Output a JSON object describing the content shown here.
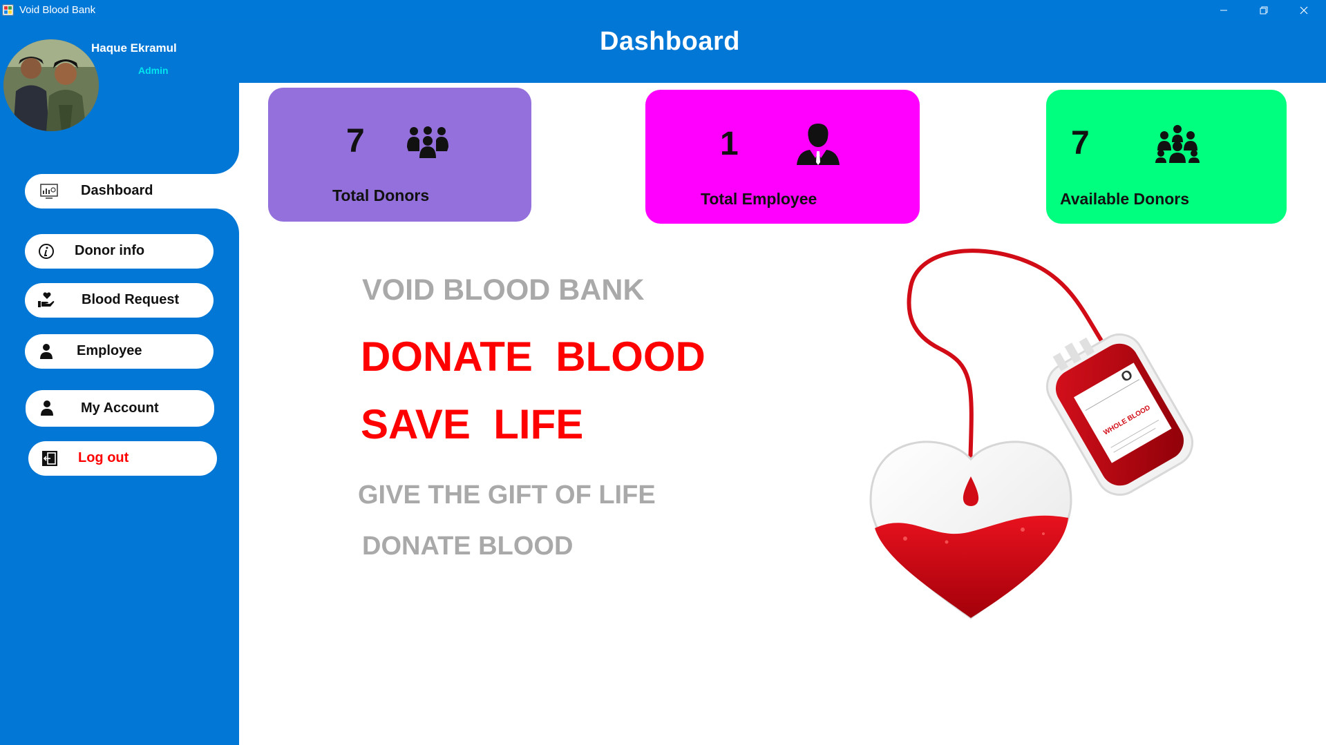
{
  "window": {
    "title": "Void Blood Bank",
    "controls": [
      "minimize-icon",
      "restore-icon",
      "close-icon"
    ]
  },
  "user": {
    "name": "Haque Ekramul",
    "role": "Admin"
  },
  "sidebar": {
    "items": [
      {
        "label": "Dashboard",
        "icon": "dashboard-icon",
        "active": true
      },
      {
        "label": "Donor info",
        "icon": "info-icon"
      },
      {
        "label": "Blood Request",
        "icon": "hand-heart-icon"
      },
      {
        "label": "Employee",
        "icon": "user-icon"
      },
      {
        "label": "My Account",
        "icon": "user-icon"
      },
      {
        "label": "Log out",
        "icon": "logout-icon",
        "color": "#ff0000"
      }
    ]
  },
  "header": {
    "title": "Dashboard"
  },
  "stats": [
    {
      "value": "7",
      "label": "Total Donors",
      "icon": "group-icon",
      "color": "#9370db"
    },
    {
      "value": "1",
      "label": "Total Employee",
      "icon": "employee-icon",
      "color": "#ff00ff"
    },
    {
      "value": "7",
      "label": "Available Donors",
      "icon": "users-icon",
      "color": "#00ff7f"
    }
  ],
  "content": {
    "bank_name": "VOID BLOOD BANK",
    "headline1": "DONATE  BLOOD",
    "headline2": "SAVE  LIFE",
    "tagline1": "GIVE THE GIFT OF LIFE",
    "tagline2": "DONATE BLOOD"
  },
  "illustration": {
    "bag_label": "WHOLE BLOOD",
    "bag_type": "O"
  },
  "colors": {
    "primary": "#0277d6",
    "accent_red": "#ff0000",
    "muted_gray": "#a9a9a9"
  }
}
